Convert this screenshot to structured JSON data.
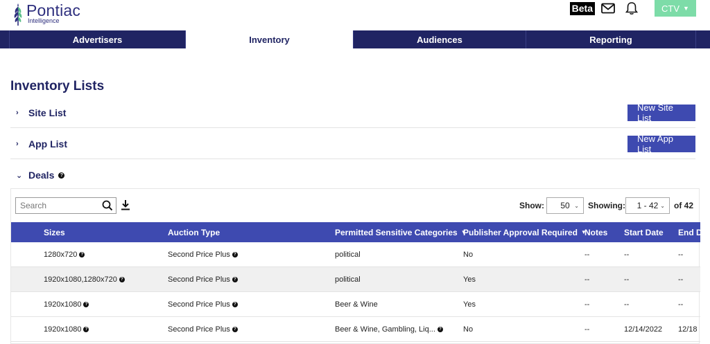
{
  "header": {
    "logo_name": "Pontiac",
    "logo_sub": "Intelligence",
    "beta": "Beta",
    "ctv": "CTV",
    "icons": [
      "mail-icon",
      "bell-icon"
    ]
  },
  "nav": {
    "tabs": [
      {
        "label": "Advertisers"
      },
      {
        "label": "Inventory",
        "active": true
      },
      {
        "label": "Audiences"
      },
      {
        "label": "Reporting"
      }
    ]
  },
  "page": {
    "title": "Inventory Lists",
    "site_list": {
      "label": "Site List",
      "button": "New Site List"
    },
    "app_list": {
      "label": "App List",
      "button": "New App List"
    },
    "deals": {
      "label": "Deals",
      "help": "?"
    }
  },
  "toolbar": {
    "search_placeholder": "Search",
    "show_label": "Show:",
    "show_value": "50",
    "showing_label": "Showing:",
    "showing_value": "1 - 42",
    "of_total": "of 42"
  },
  "table": {
    "headers": {
      "sizes": "Sizes",
      "auction": "Auction Type",
      "categories": "Permitted Sensitive Categories",
      "approval": "Publisher Approval Required",
      "notes": "Notes",
      "start": "Start Date",
      "end": "End D"
    },
    "rows": [
      {
        "sizes": "1280x720",
        "auction": "Second Price Plus",
        "categories": "political",
        "approval": "No",
        "notes": "--",
        "start": "--",
        "end": "--",
        "cat_help": false
      },
      {
        "sizes": "1920x1080,1280x720",
        "auction": "Second Price Plus",
        "categories": "political",
        "approval": "Yes",
        "notes": "--",
        "start": "--",
        "end": "--",
        "cat_help": false
      },
      {
        "sizes": "1920x1080",
        "auction": "Second Price Plus",
        "categories": "Beer & Wine",
        "approval": "Yes",
        "notes": "--",
        "start": "--",
        "end": "--",
        "cat_help": false
      },
      {
        "sizes": "1920x1080",
        "auction": "Second Price Plus",
        "categories": "Beer & Wine, Gambling, Liq...",
        "approval": "No",
        "notes": "--",
        "start": "12/14/2022",
        "end": "12/18",
        "cat_help": true
      }
    ]
  },
  "colors": {
    "nav_bg": "#202463",
    "accent": "#3e4ab0",
    "ctv_green": "#7ddca8"
  }
}
